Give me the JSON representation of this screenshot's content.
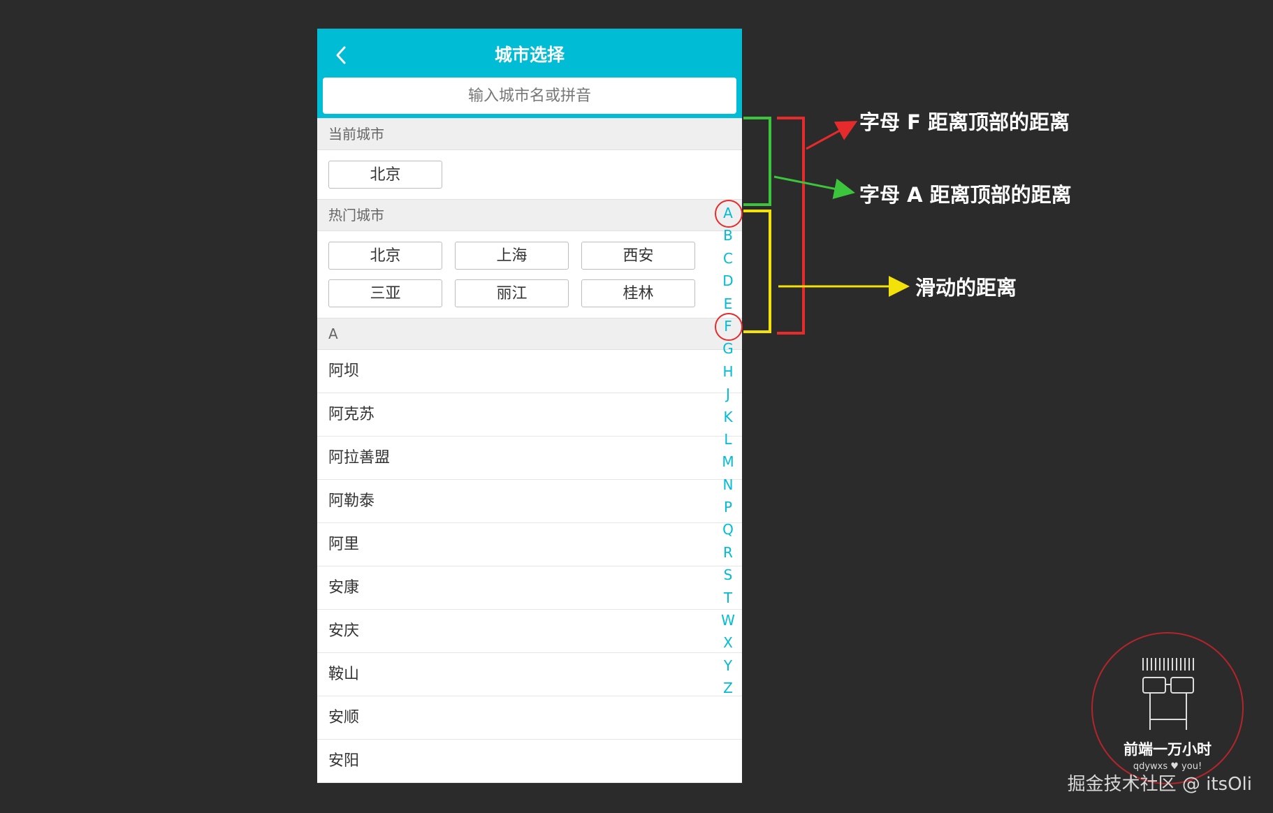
{
  "header": {
    "title": "城市选择",
    "search_placeholder": "输入城市名或拼音"
  },
  "current": {
    "label": "当前城市",
    "city": "北京"
  },
  "hot": {
    "label": "热门城市",
    "cities": [
      "北京",
      "上海",
      "西安",
      "三亚",
      "丽江",
      "桂林"
    ]
  },
  "group_a": {
    "label": "A",
    "cities": [
      "阿坝",
      "阿克苏",
      "阿拉善盟",
      "阿勒泰",
      "阿里",
      "安康",
      "安庆",
      "鞍山",
      "安顺",
      "安阳"
    ]
  },
  "alphabet": [
    "A",
    "B",
    "C",
    "D",
    "E",
    "F",
    "G",
    "H",
    "J",
    "K",
    "L",
    "M",
    "N",
    "P",
    "Q",
    "R",
    "S",
    "T",
    "W",
    "X",
    "Y",
    "Z"
  ],
  "annotations": {
    "f_distance": "字母 F 距离顶部的距离",
    "a_distance": "字母 A 距离顶部的距离",
    "scroll_distance": "滑动的距离"
  },
  "logo": {
    "title": "前端一万小时",
    "subtitle": "qdywxs ♥ you!"
  },
  "watermark": "掘金技术社区 @ itsOli",
  "colors": {
    "primary": "#00bcd4",
    "red": "#e52b2b",
    "green": "#3dc43d",
    "yellow": "#f2e20a"
  }
}
